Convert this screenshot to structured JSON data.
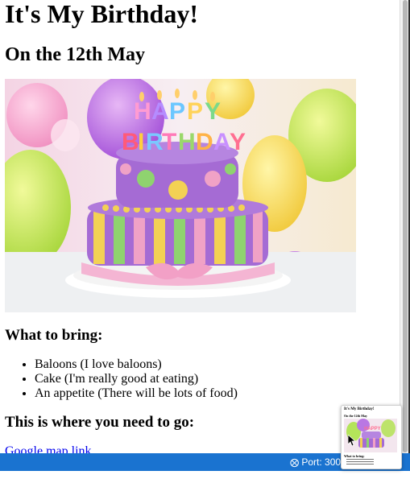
{
  "page": {
    "title": "It's My Birthday!",
    "subtitle": "On the 12th May",
    "hero_image_text": "HAPPY BIRTHDAY",
    "bring_heading": "What to bring:",
    "bring_items": [
      "Baloons (I love baloons)",
      "Cake (I'm really good at eating)",
      "An appetite (There will be lots of food)"
    ],
    "where_heading": "This is where you need to go:",
    "map_link": "Google map link"
  },
  "status_bar": {
    "port_icon": "broadcast-icon",
    "port_text": "Port: 300"
  },
  "preview": {
    "title": "It's My Birthday!",
    "subtitle": "On the 12th May",
    "section": "What to bring:"
  },
  "colors": {
    "link": "#0000ee",
    "status_bar": "#1a73d0",
    "background": "#ffffff"
  }
}
